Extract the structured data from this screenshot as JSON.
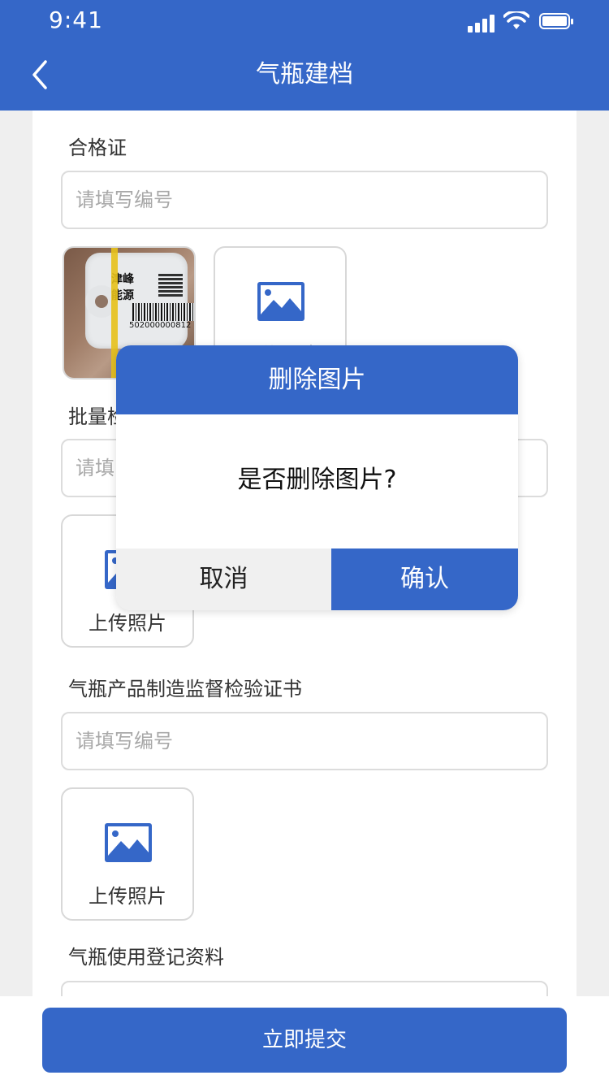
{
  "status_bar": {
    "time": "9:41"
  },
  "nav": {
    "title": "气瓶建档"
  },
  "form": {
    "certificate": {
      "label": "合格证",
      "placeholder": "请填写编号"
    },
    "batch": {
      "label": "批量检",
      "placeholder": "请填"
    },
    "supervision": {
      "label": "气瓶产品制造监督检验证书",
      "placeholder": "请填写编号"
    },
    "registration": {
      "label": "气瓶使用登记资料"
    },
    "upload_label": "上传照片",
    "photo_tag": {
      "brand_line1": "津峰",
      "brand_line2": "能源",
      "serial": "502000000812"
    }
  },
  "dialog": {
    "title": "删除图片",
    "message": "是否删除图片?",
    "cancel": "取消",
    "confirm": "确认"
  },
  "footer": {
    "submit": "立即提交"
  },
  "colors": {
    "primary": "#3567c8",
    "background": "#efefef"
  },
  "icons": [
    "back-icon",
    "image-icon",
    "signal-icon",
    "wifi-icon",
    "battery-icon"
  ]
}
